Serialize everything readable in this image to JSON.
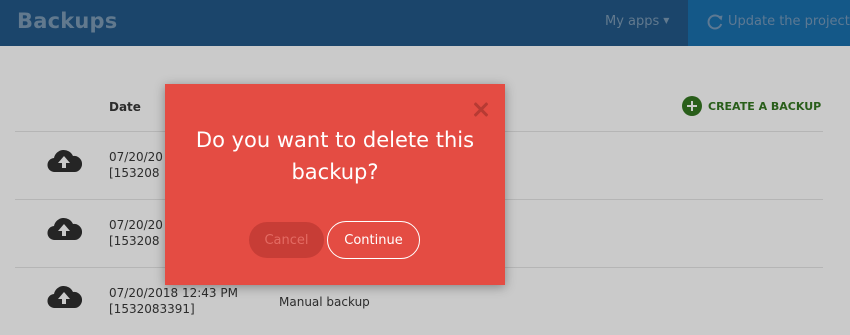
{
  "header": {
    "title": "Backups",
    "my_apps_label": "My apps",
    "update_label": "Update the project"
  },
  "table": {
    "date_header": "Date",
    "create_label": "CREATE A BACKUP",
    "rows": [
      {
        "date": "07/20/20",
        "id": "[153208",
        "type": ""
      },
      {
        "date": "07/20/20",
        "id": "[153208",
        "type": ""
      },
      {
        "date": "07/20/2018 12:43 PM",
        "id": "[1532083391]",
        "type": "Manual backup"
      }
    ]
  },
  "modal": {
    "question": "Do you want to delete this backup?",
    "cancel_label": "Cancel",
    "continue_label": "Continue"
  },
  "colors": {
    "topbar": "#1f4f7a",
    "modal": "#e44c43",
    "accent_green": "#2f6b1e"
  },
  "icons": {
    "header": [
      "chevron-down-icon",
      "refresh-icon"
    ],
    "row": "cloud-upload-icon",
    "create": "plus-circle-icon",
    "modal_close": "close-icon"
  }
}
